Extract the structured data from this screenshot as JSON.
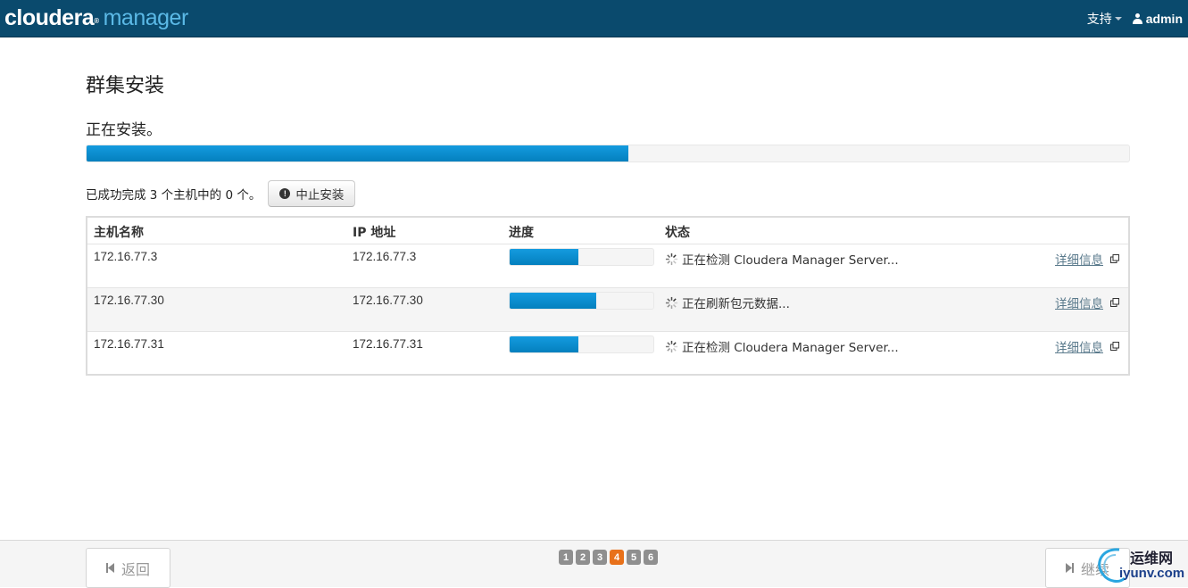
{
  "navbar": {
    "brand_main": "cloudera",
    "brand_reg": "®",
    "brand_sub": "manager",
    "support_label": "支持",
    "user_label": "admin"
  },
  "page": {
    "title": "群集安装",
    "status": "正在安装。",
    "overall_progress": 0.52,
    "summary": "已成功完成 3 个主机中的 0 个。",
    "abort_label": "中止安装"
  },
  "table": {
    "headers": {
      "hostname": "主机名称",
      "ip": "IP 地址",
      "progress": "进度",
      "status": "状态"
    },
    "rows": [
      {
        "hostname": "172.16.77.3",
        "ip": "172.16.77.3",
        "progress": 0.48,
        "status": "正在检测 Cloudera Manager Server...",
        "details": "详细信息"
      },
      {
        "hostname": "172.16.77.30",
        "ip": "172.16.77.30",
        "progress": 0.6,
        "status": "正在刷新包元数据...",
        "details": "详细信息"
      },
      {
        "hostname": "172.16.77.31",
        "ip": "172.16.77.31",
        "progress": 0.48,
        "status": "正在检测 Cloudera Manager Server...",
        "details": "详细信息"
      }
    ]
  },
  "footer": {
    "back_label": "返回",
    "continue_label": "继续",
    "steps": [
      "1",
      "2",
      "3",
      "4",
      "5",
      "6"
    ],
    "active_step": "4"
  },
  "watermark": {
    "cn": "运维网",
    "en": "iyunv.com"
  },
  "colors": {
    "navbar": "#0a4a6d",
    "brand_accent": "#5bb9e6",
    "progress": "#0e90d2",
    "active_step": "#e8711a"
  }
}
